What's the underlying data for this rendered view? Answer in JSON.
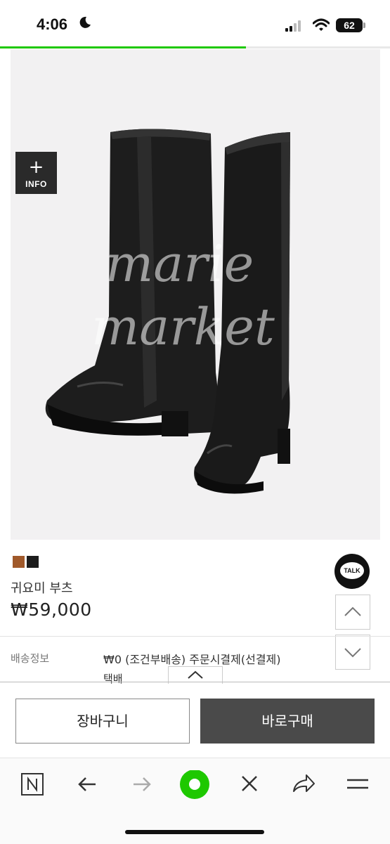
{
  "status_bar": {
    "time": "4:06",
    "battery": "62"
  },
  "page_load_progress": 0.63,
  "product": {
    "info_plus": "+",
    "info_label": "INFO",
    "swatches": [
      "#a0592a",
      "#1c1c1c"
    ],
    "name": "귀요미 부츠",
    "price": "₩59,000"
  },
  "kakao_talk": {
    "label": "TALK"
  },
  "shipping": {
    "label": "배송정보",
    "value": "₩0 (조건부배송) 주문시결제(선결제)",
    "method": "택배"
  },
  "actions": {
    "cart_label": "장바구니",
    "buy_label": "바로구매"
  },
  "browser_nav": {
    "icons": [
      "naver-n-icon",
      "back-arrow-icon",
      "forward-arrow-icon",
      "green-dot-icon",
      "close-icon",
      "share-icon",
      "menu-icon"
    ],
    "accent_color": "#1ec800"
  }
}
